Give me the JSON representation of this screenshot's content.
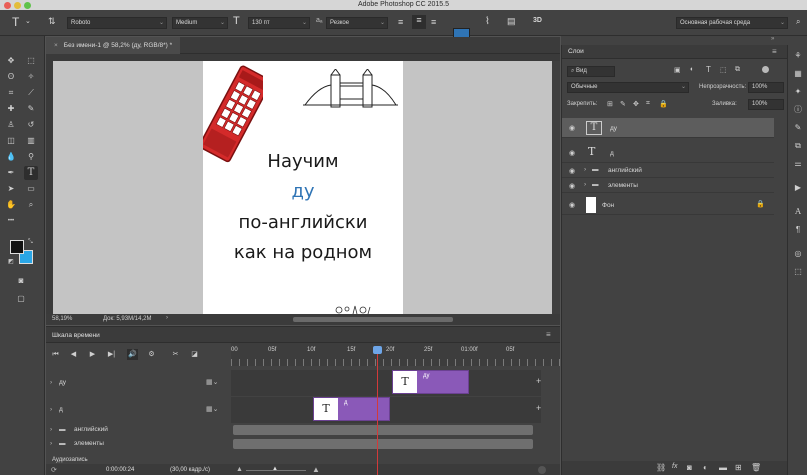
{
  "window": {
    "title": "Adobe Photoshop CC 2015.5",
    "traffic": [
      "#e95e57",
      "#e3bd3b",
      "#5fc24a"
    ]
  },
  "options": {
    "tool_glyph": "T",
    "font_family": "Roboto",
    "font_style": "Medium",
    "font_size": "130 пт",
    "aa": "Резкое",
    "workspace": "Основная рабочая среда",
    "text_color": "#2f74b5"
  },
  "document": {
    "tab": "Без имени-1 @ 58,2% (ду, RGB/8*) *",
    "zoom": "58,19%",
    "doc_info": "Док: 5,93M/14,2M",
    "poster": {
      "line1": "Научим",
      "line2": "ду",
      "line3": "по-английски",
      "line4": "как на родном"
    }
  },
  "timeline": {
    "title": "Шкала времени",
    "ticks": [
      "00",
      "05f",
      "10f",
      "15f",
      "20f",
      "25f",
      "01:00f",
      "05f"
    ],
    "tracks": [
      {
        "name": "ду"
      },
      {
        "name": "д"
      },
      {
        "name": "английский"
      },
      {
        "name": "элементы"
      }
    ],
    "clip1_label": "ду",
    "clip2_label": "д",
    "audio_label": "Аудиозапись",
    "timecode": "0:00:00:24",
    "fps": "(30,00 кадр./с)"
  },
  "layers": {
    "tab": "Слои",
    "filter": "Вид",
    "blend": "Обычные",
    "opacity_label": "Непрозрачность:",
    "opacity": "100%",
    "lock_label": "Закрепить:",
    "fill_label": "Заливка:",
    "fill": "100%",
    "rows": [
      {
        "name": "ду",
        "type": "text"
      },
      {
        "name": "д",
        "type": "text"
      },
      {
        "name": "английский",
        "type": "group"
      },
      {
        "name": "элементы",
        "type": "group"
      },
      {
        "name": "Фон",
        "type": "background"
      }
    ]
  },
  "colors": {
    "foreground": "#111111",
    "background": "#2aa6e6"
  }
}
